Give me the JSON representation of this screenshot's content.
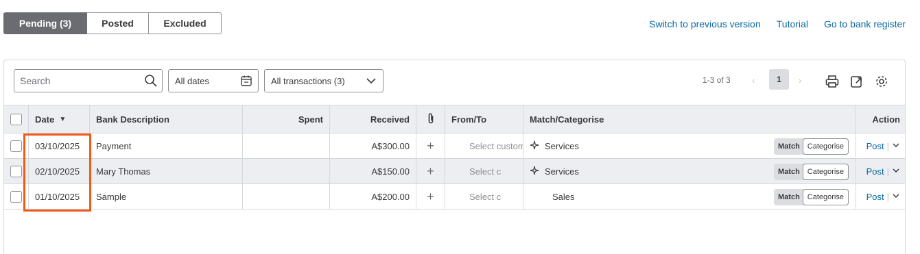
{
  "tabs": [
    {
      "label": "Pending (3)"
    },
    {
      "label": "Posted"
    },
    {
      "label": "Excluded"
    }
  ],
  "links": {
    "switch": "Switch to previous version",
    "tutorial": "Tutorial",
    "register": "Go to bank register"
  },
  "toolbar": {
    "search_placeholder": "Search",
    "dates": "All dates",
    "transactions": "All transactions (3)"
  },
  "pager": {
    "range": "1-3 of 3",
    "prev": "‹",
    "page": "1",
    "next": "›"
  },
  "columns": {
    "date": "Date",
    "sort_arrow": "▼",
    "description": "Bank Description",
    "spent": "Spent",
    "received": "Received",
    "from_to": "From/To",
    "match": "Match/Categorise",
    "action": "Action"
  },
  "rows": [
    {
      "date": "03/10/2025",
      "description": "Payment",
      "spent": "",
      "received": "A$300.00",
      "from_to": "Select customer",
      "category": "Services",
      "match_btn": "Match",
      "cat_btn": "Categorise",
      "post": "Post"
    },
    {
      "date": "02/10/2025",
      "description": "Mary Thomas",
      "spent": "",
      "received": "A$150.00",
      "from_to": "Select c",
      "category": "Services",
      "match_btn": "Match",
      "cat_btn": "Categorise",
      "post": "Post"
    },
    {
      "date": "01/10/2025",
      "description": "Sample",
      "spent": "",
      "received": "A$200.00",
      "from_to": "Select c",
      "category": "Sales",
      "match_btn": "Match",
      "cat_btn": "Categorise",
      "post": "Post"
    }
  ],
  "icons": {
    "plus": "+",
    "separator": "|"
  },
  "colors": {
    "accent_link": "#0a6aa3",
    "highlight": "#f05a16",
    "active_tab": "#6b6c72"
  }
}
